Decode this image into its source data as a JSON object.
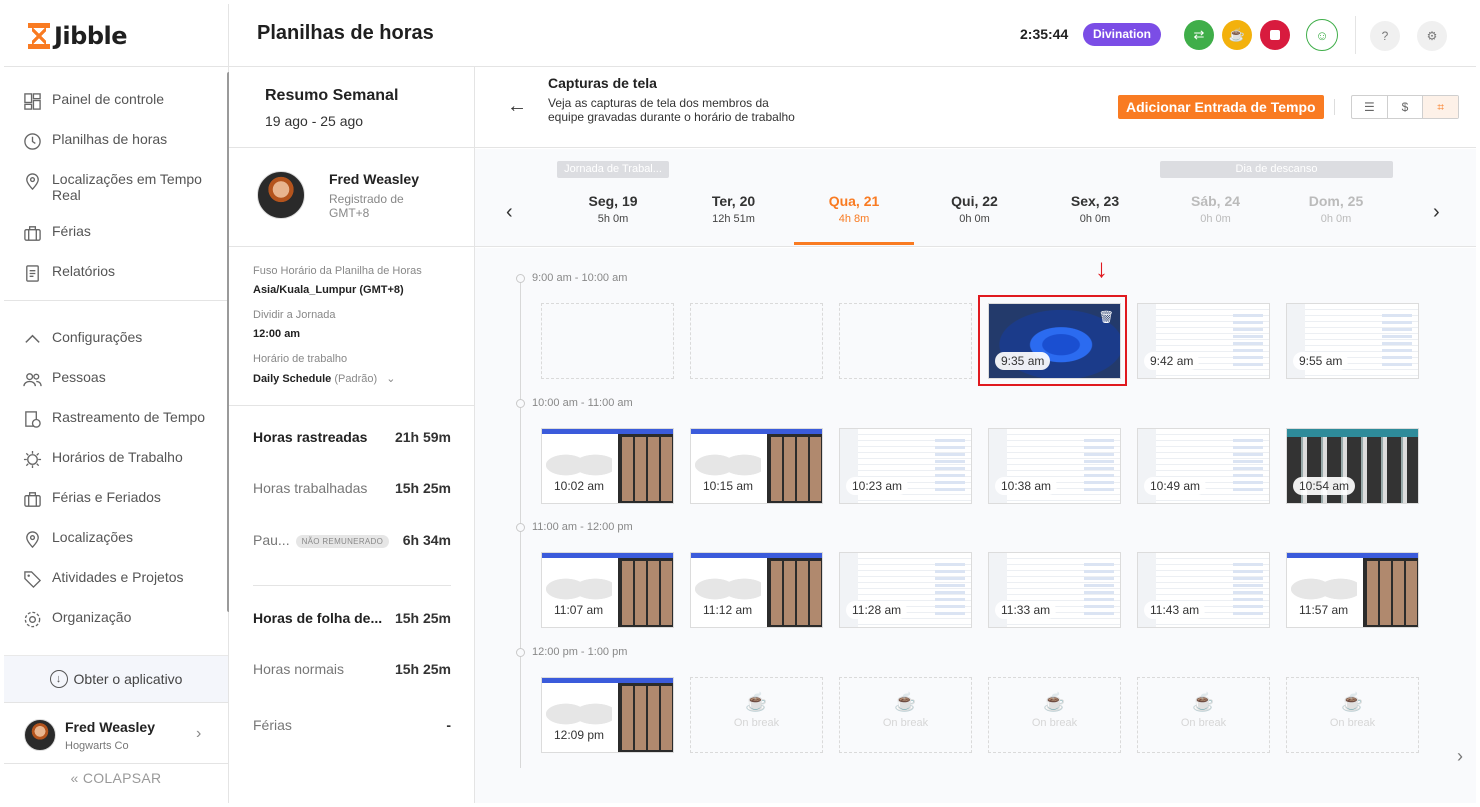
{
  "app": {
    "logo_text": "Jibble",
    "page_title": "Planilhas de horas"
  },
  "sidebar": {
    "items_top": [
      {
        "label": "Painel de controle",
        "icon": "dashboard-icon"
      },
      {
        "label": "Planilhas de horas",
        "icon": "clock-icon"
      },
      {
        "label": "Localizações em Tempo Real",
        "icon": "location-pin-icon"
      },
      {
        "label": "Férias",
        "icon": "suitcase-icon"
      },
      {
        "label": "Relatórios",
        "icon": "report-icon"
      }
    ],
    "items_bottom": [
      {
        "label": "Configurações",
        "icon": "chevron-up-icon"
      },
      {
        "label": "Pessoas",
        "icon": "people-icon"
      },
      {
        "label": "Rastreamento de Tempo",
        "icon": "time-tracking-icon"
      },
      {
        "label": "Horários de Trabalho",
        "icon": "work-schedule-icon"
      },
      {
        "label": "Férias e Feriados",
        "icon": "suitcase-icon"
      },
      {
        "label": "Localizações",
        "icon": "location-pin-icon"
      },
      {
        "label": "Atividades e Projetos",
        "icon": "tag-icon"
      },
      {
        "label": "Organização",
        "icon": "gear-icon"
      }
    ],
    "get_app": "Obter o aplicativo",
    "user": {
      "name": "Fred Weasley",
      "company": "Hogwarts Co"
    },
    "collapse": "COLAPSAR"
  },
  "topbar": {
    "clock": "2:35:44",
    "activity_badge": "Divination",
    "accent": "#7b4de6"
  },
  "summary": {
    "title": "Resumo Semanal",
    "range": "19 ago - 25 ago",
    "employee": {
      "name": "Fred Weasley",
      "registered": "Registrado de GMT+8"
    },
    "timezone_label": "Fuso Horário da Planilha de Horas",
    "timezone_value": "Asia/Kuala_Lumpur (GMT+8)",
    "split_label": "Dividir a Jornada",
    "split_value": "12:00 am",
    "schedule_label": "Horário de trabalho",
    "schedule_value": "Daily Schedule",
    "schedule_suffix": "(Padrão)",
    "stats": [
      {
        "label": "Horas rastreadas",
        "value": "21h 59m"
      },
      {
        "label": "Horas trabalhadas",
        "value": "15h 25m"
      },
      {
        "label": "Pau...",
        "pill": "NÃO REMUNERADO",
        "value": "6h 34m"
      },
      {
        "label": "Horas de folha de...",
        "value": "15h 25m"
      },
      {
        "label": "Horas normais",
        "value": "15h 25m"
      },
      {
        "label": "Férias",
        "value": "-"
      }
    ]
  },
  "screenshots": {
    "title": "Capturas de tela",
    "description": "Veja as capturas de tela dos membros da equipe gravadas durante o horário de trabalho",
    "add_button": "Adicionar Entrada de Tempo",
    "tag_workday": "Jornada de Trabal...",
    "tag_rest": "Dia de descanso",
    "brand": "#f97b22",
    "days": [
      {
        "name": "Seg, 19",
        "hours": "5h 0m",
        "state": "normal"
      },
      {
        "name": "Ter, 20",
        "hours": "12h 51m",
        "state": "normal"
      },
      {
        "name": "Qua, 21",
        "hours": "4h 8m",
        "state": "active"
      },
      {
        "name": "Qui, 22",
        "hours": "0h 0m",
        "state": "normal"
      },
      {
        "name": "Sex, 23",
        "hours": "0h 0m",
        "state": "normal"
      },
      {
        "name": "Sáb, 24",
        "hours": "0h 0m",
        "state": "off"
      },
      {
        "name": "Dom, 25",
        "hours": "0h 0m",
        "state": "off"
      }
    ],
    "hours": [
      {
        "label": "9:00 am - 10:00 am",
        "thumbs": [
          {
            "type": "empty"
          },
          {
            "type": "empty"
          },
          {
            "type": "empty"
          },
          {
            "type": "win",
            "time": "9:35 am"
          },
          {
            "type": "list",
            "time": "9:42 am"
          },
          {
            "type": "list",
            "time": "9:55 am"
          }
        ]
      },
      {
        "label": "10:00 am - 11:00 am",
        "thumbs": [
          {
            "type": "meet",
            "time": "10:02 am"
          },
          {
            "type": "meet",
            "time": "10:15 am"
          },
          {
            "type": "list",
            "time": "10:23 am"
          },
          {
            "type": "list",
            "time": "10:38 am"
          },
          {
            "type": "list",
            "time": "10:49 am"
          },
          {
            "type": "grid",
            "time": "10:54 am"
          }
        ]
      },
      {
        "label": "11:00 am - 12:00 pm",
        "thumbs": [
          {
            "type": "meet",
            "time": "11:07 am"
          },
          {
            "type": "meet",
            "time": "11:12 am"
          },
          {
            "type": "list",
            "time": "11:28 am"
          },
          {
            "type": "list",
            "time": "11:33 am"
          },
          {
            "type": "list",
            "time": "11:43 am"
          },
          {
            "type": "meet",
            "time": "11:57 am"
          }
        ]
      },
      {
        "label": "12:00 pm - 1:00 pm",
        "thumbs": [
          {
            "type": "meet",
            "time": "12:09 pm"
          },
          {
            "type": "break",
            "time": "On break"
          },
          {
            "type": "break",
            "time": "On break"
          },
          {
            "type": "break",
            "time": "On break"
          },
          {
            "type": "break",
            "time": "On break"
          },
          {
            "type": "break",
            "time": "On break"
          }
        ]
      }
    ]
  }
}
